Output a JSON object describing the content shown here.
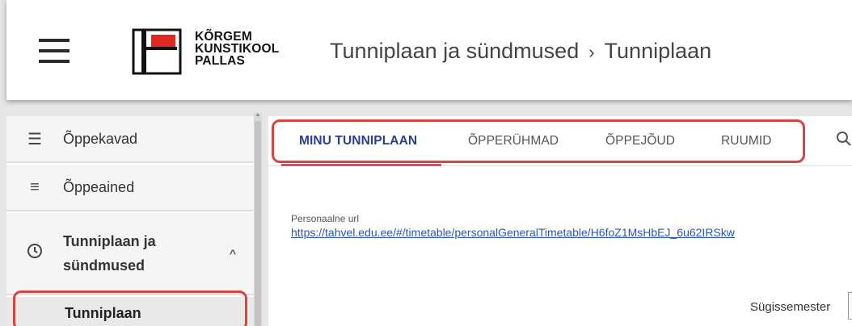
{
  "header": {
    "logo_lines": [
      "KÕRGEM",
      "KUNSTIKOOL",
      "PALLAS"
    ],
    "breadcrumb": {
      "parent": "Tunniplaan ja sündmused",
      "separator": "›",
      "current": "Tunniplaan"
    }
  },
  "sidebar": {
    "items": [
      {
        "label": "Õppekavad",
        "icon": "list-icon"
      },
      {
        "label": "Õppeained",
        "icon": "lines-icon"
      },
      {
        "label_line1": "Tunniplaan ja",
        "label_line2": "sündmused",
        "icon": "clock-icon",
        "expanded": true
      }
    ],
    "sub_item": "Tunniplaan"
  },
  "tabs": {
    "items": [
      "MINU TUNNIPLAAN",
      "ÕPPERÜHMAD",
      "ÕPPEJÕUD",
      "RUUMID"
    ],
    "active": "MINU TUNNIPLAAN"
  },
  "content": {
    "url_label": "Personaalne url",
    "url": "https://tahvel.edu.ee/#/timetable/personalGeneralTimetable/H6foZ1MsHbEJ_6u62IRSkw",
    "semester_label": "Sügissemester"
  },
  "colors": {
    "highlight": "#d6453f",
    "active_tab": "#2a3f8f",
    "tab_underline": "#e8417c",
    "logo_red": "#e0281f"
  }
}
